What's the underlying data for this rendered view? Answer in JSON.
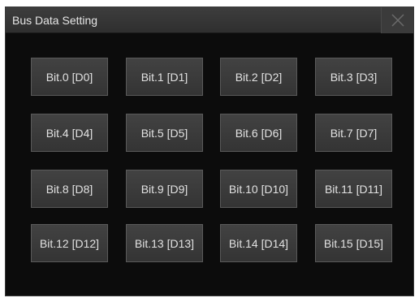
{
  "dialog": {
    "title": "Bus Data Setting",
    "close_icon": "close-icon"
  },
  "buttons": [
    "Bit.0 [D0]",
    "Bit.1 [D1]",
    "Bit.2 [D2]",
    "Bit.3 [D3]",
    "Bit.4 [D4]",
    "Bit.5 [D5]",
    "Bit.6 [D6]",
    "Bit.7 [D7]",
    "Bit.8 [D8]",
    "Bit.9 [D9]",
    "Bit.10 [D10]",
    "Bit.11 [D11]",
    "Bit.12 [D12]",
    "Bit.13 [D13]",
    "Bit.14 [D14]",
    "Bit.15 [D15]"
  ],
  "colors": {
    "dialog_background": "#0c0c0c",
    "titlebar": "#353535",
    "button": "#3b3b3b",
    "text": "#e2e2e2"
  }
}
